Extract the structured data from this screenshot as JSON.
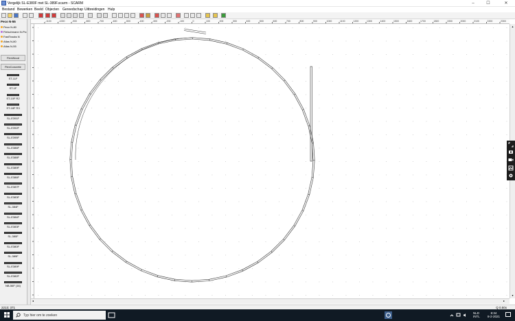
{
  "window": {
    "title": "Vergelijk SL-E380F met SL-389F.scarm - SCARM",
    "minimize": "–",
    "maximize": "☐",
    "close": "✕"
  },
  "menu": [
    "Bestand",
    "Bewerken",
    "Beeld",
    "Objecten",
    "Gereedschap",
    "Uitbreidingen",
    "Hulp"
  ],
  "sidebar": {
    "library_title": "Peco N-55",
    "libraries": [
      {
        "label": "Peco N-80",
        "color": "orange"
      },
      {
        "label": "Fleischmann N-Pic",
        "color": "purple"
      },
      {
        "label": "FastTracks N",
        "color": "orange"
      },
      {
        "label": "Atlas N-80",
        "color": "orange"
      },
      {
        "label": "Atlas N-55",
        "color": "orange"
      }
    ],
    "flex_wood": "FlexWood",
    "flex_concrete": "FlexConcrete",
    "tracks": [
      "ST-11F",
      "ST-1F",
      "ST-10F R2",
      "ST-18F R3",
      "SL-E391F",
      "SL-E392F",
      "SL-E395F",
      "SL-E386F",
      "SL-E388F",
      "SL-E389F",
      "SL-E386F",
      "SL-E387F",
      "SL-E383F",
      "SL-384F",
      "SL-E384F",
      "SL-E383F",
      "SL-380F",
      "SL-E380F",
      "SL-389F",
      "SL-E389F",
      "SL-E382F",
      "NB-56F (16)"
    ]
  },
  "ruler": {
    "h_ticks": [
      "-1100",
      "-1000",
      "-900",
      "-800",
      "-700",
      "-600",
      "-500",
      "-400",
      "-300",
      "-200",
      "-100",
      "0",
      "100",
      "200",
      "300",
      "400",
      "500",
      "600",
      "700",
      "800",
      "900",
      "1000",
      "1100",
      "1200",
      "1300",
      "1400",
      "1500",
      "1600",
      "1700",
      "1800",
      "1900",
      "2000",
      "2100",
      "2200",
      "2300"
    ]
  },
  "status": {
    "coords": "2213; 371",
    "zoom": "Q 0.50x"
  },
  "taskbar": {
    "search_placeholder": "Typ hier om te zoeken",
    "lang1": "NLD",
    "lang2": "INTL",
    "time": "8:34",
    "date": "8-2-2021"
  },
  "colors": {
    "track": "#333333",
    "grid_dot": "#c8c8c8",
    "taskbar": "#101a24"
  }
}
